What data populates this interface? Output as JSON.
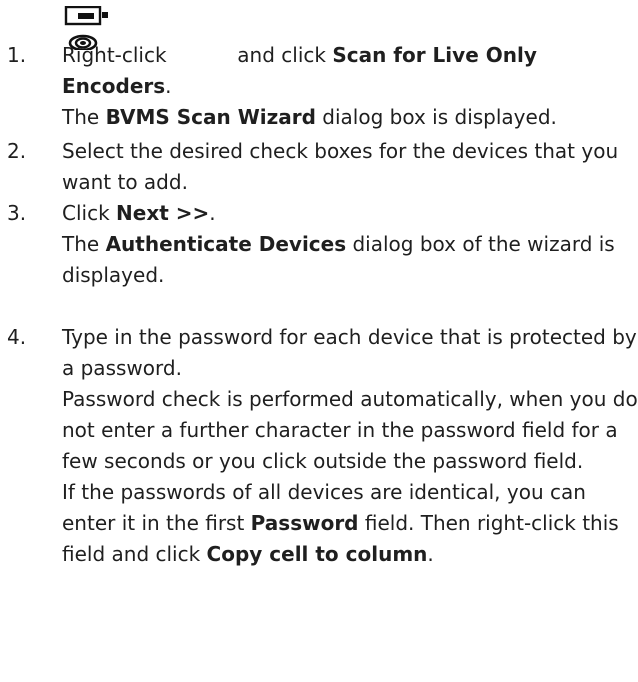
{
  "steps": [
    {
      "number": "1.",
      "instruction": {
        "pre": "Right-click ",
        "mid": " and click ",
        "bold": "Scan for Live Only Encoders",
        "post": "."
      },
      "result": {
        "pre": "The ",
        "bold": "BVMS Scan Wizard",
        "post": " dialog box is displayed."
      },
      "icon": "live-only-encoder-icon"
    },
    {
      "number": "2.",
      "instruction": "Select the desired check boxes for the devices that you want to add."
    },
    {
      "number": "3.",
      "instruction": {
        "pre": "Click ",
        "bold": "Next >>",
        "post": "."
      },
      "result": {
        "pre": "The ",
        "bold": "Authenticate Devices",
        "post": " dialog box of the wizard is displayed."
      }
    },
    {
      "number": "4.",
      "instruction": "Type in the password for each device that is protected by a password.",
      "note1": "Password check is performed automatically, when you do not enter a further character in the password field for a few seconds or you click outside the password field.",
      "note2": {
        "pre": "If the passwords of all devices are identical, you can enter it in the first ",
        "bold1": "Password",
        "mid": " field. Then right-click this field and click ",
        "bold2": "Copy cell to column",
        "post": "."
      }
    }
  ]
}
